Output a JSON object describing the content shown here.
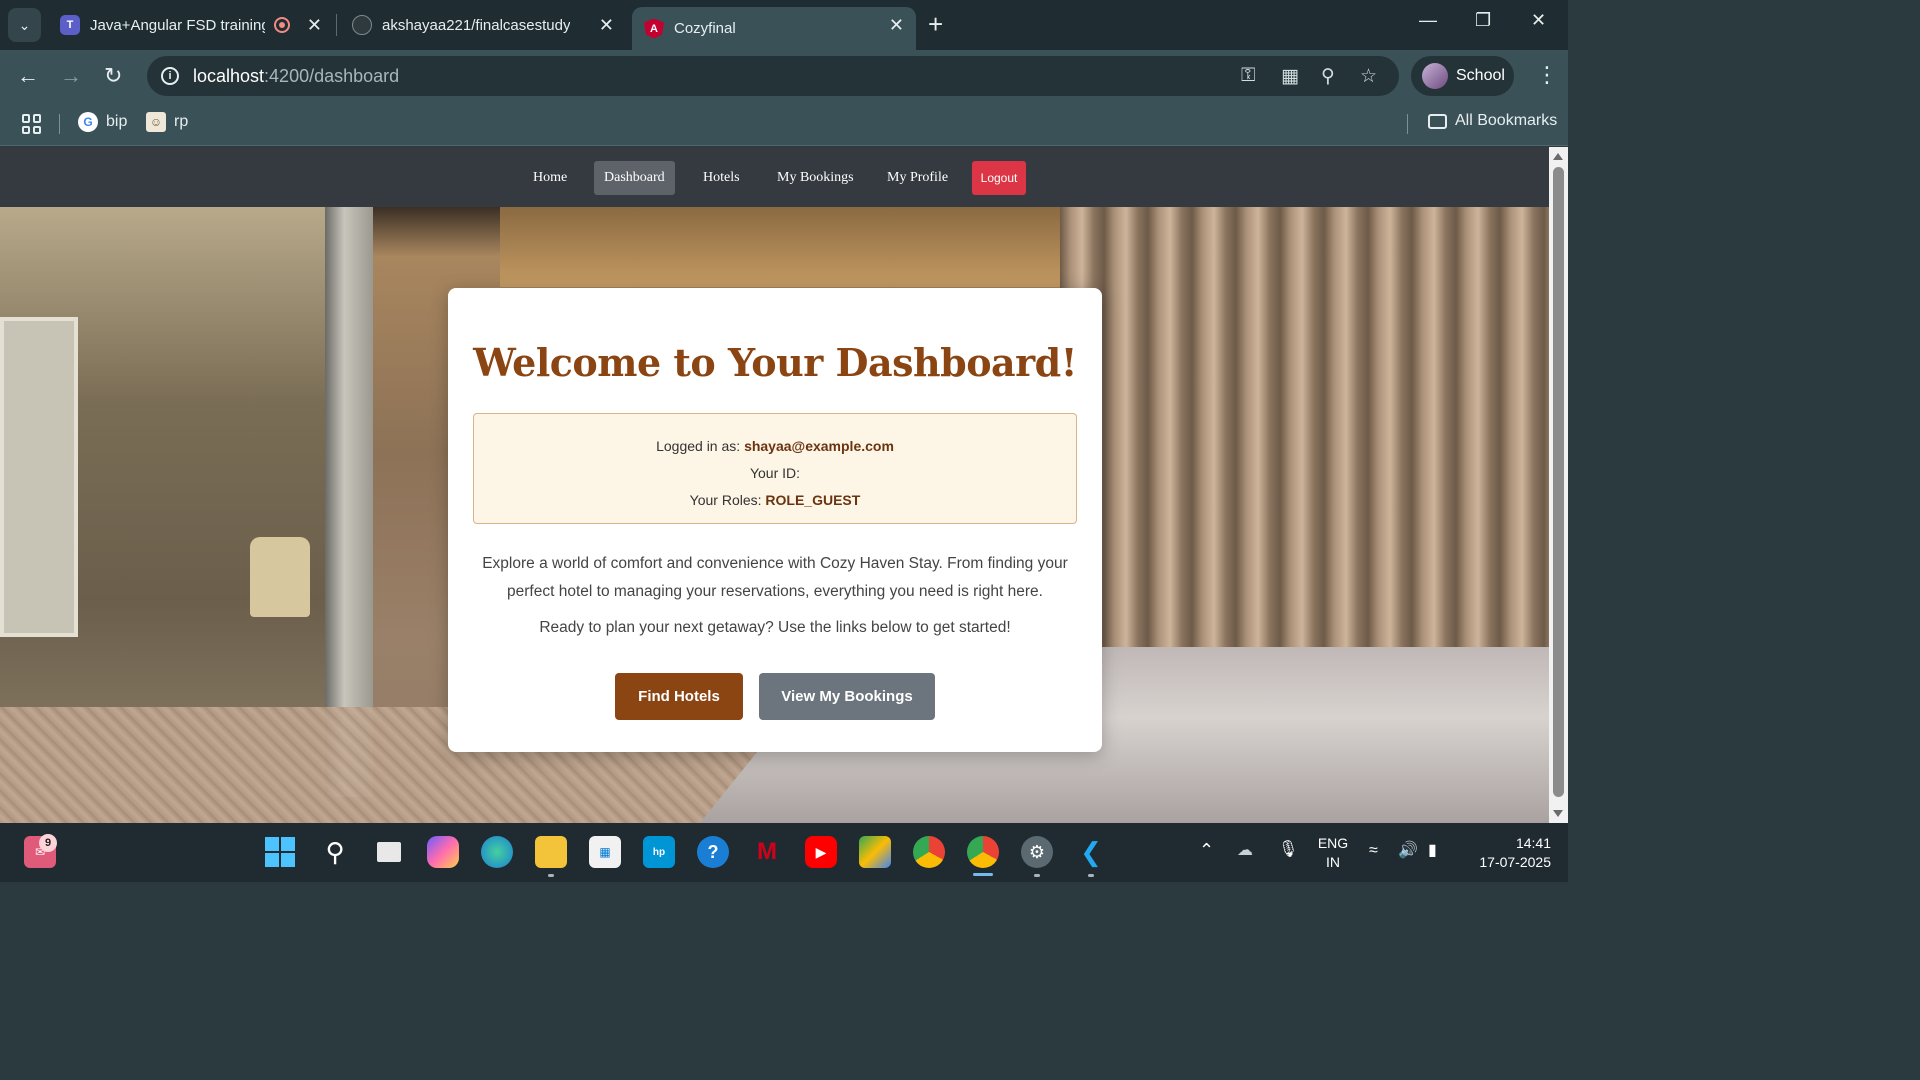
{
  "browser": {
    "tabs": [
      {
        "title": "Java+Angular FSD training",
        "icon": "teams-icon"
      },
      {
        "title": "akshayaa221/finalcasestudy",
        "icon": "github-icon"
      },
      {
        "title": "Cozyfinal",
        "icon": "angular-icon",
        "active": true
      }
    ],
    "url_host": "localhost",
    "url_path": ":4200/dashboard",
    "profile_name": "School",
    "bookmarks": [
      {
        "label": "bip",
        "icon": "google-icon"
      },
      {
        "label": "rp",
        "icon": "bookmark-image-icon"
      }
    ],
    "all_bookmarks_label": "All Bookmarks"
  },
  "site_nav": {
    "links": [
      "Home",
      "Dashboard",
      "Hotels",
      "My Bookings",
      "My Profile"
    ],
    "active": "Dashboard",
    "logout_label": "Logout"
  },
  "dashboard": {
    "title": "Welcome to Your Dashboard!",
    "logged_in_label": "Logged in as:",
    "email": "shayaa@example.com",
    "id_label": "Your ID:",
    "id_value": "",
    "roles_label": "Your Roles:",
    "roles_value": "ROLE_GUEST",
    "description": "Explore a world of comfort and convenience with Cozy Haven Stay. From finding your perfect hotel to managing your reservations, everything you need is right here.",
    "cta_text": "Ready to plan your next getaway? Use the links below to get started!",
    "find_hotels_label": "Find Hotels",
    "view_bookings_label": "View My Bookings"
  },
  "taskbar": {
    "notification_count": "9",
    "language": "ENG",
    "region": "IN",
    "time": "14:41",
    "date": "17-07-2025"
  },
  "colors": {
    "brand_brown": "#8b4513",
    "logout_red": "#dc3545",
    "secondary_gray": "#6c757d",
    "nav_dark": "#343a40"
  }
}
